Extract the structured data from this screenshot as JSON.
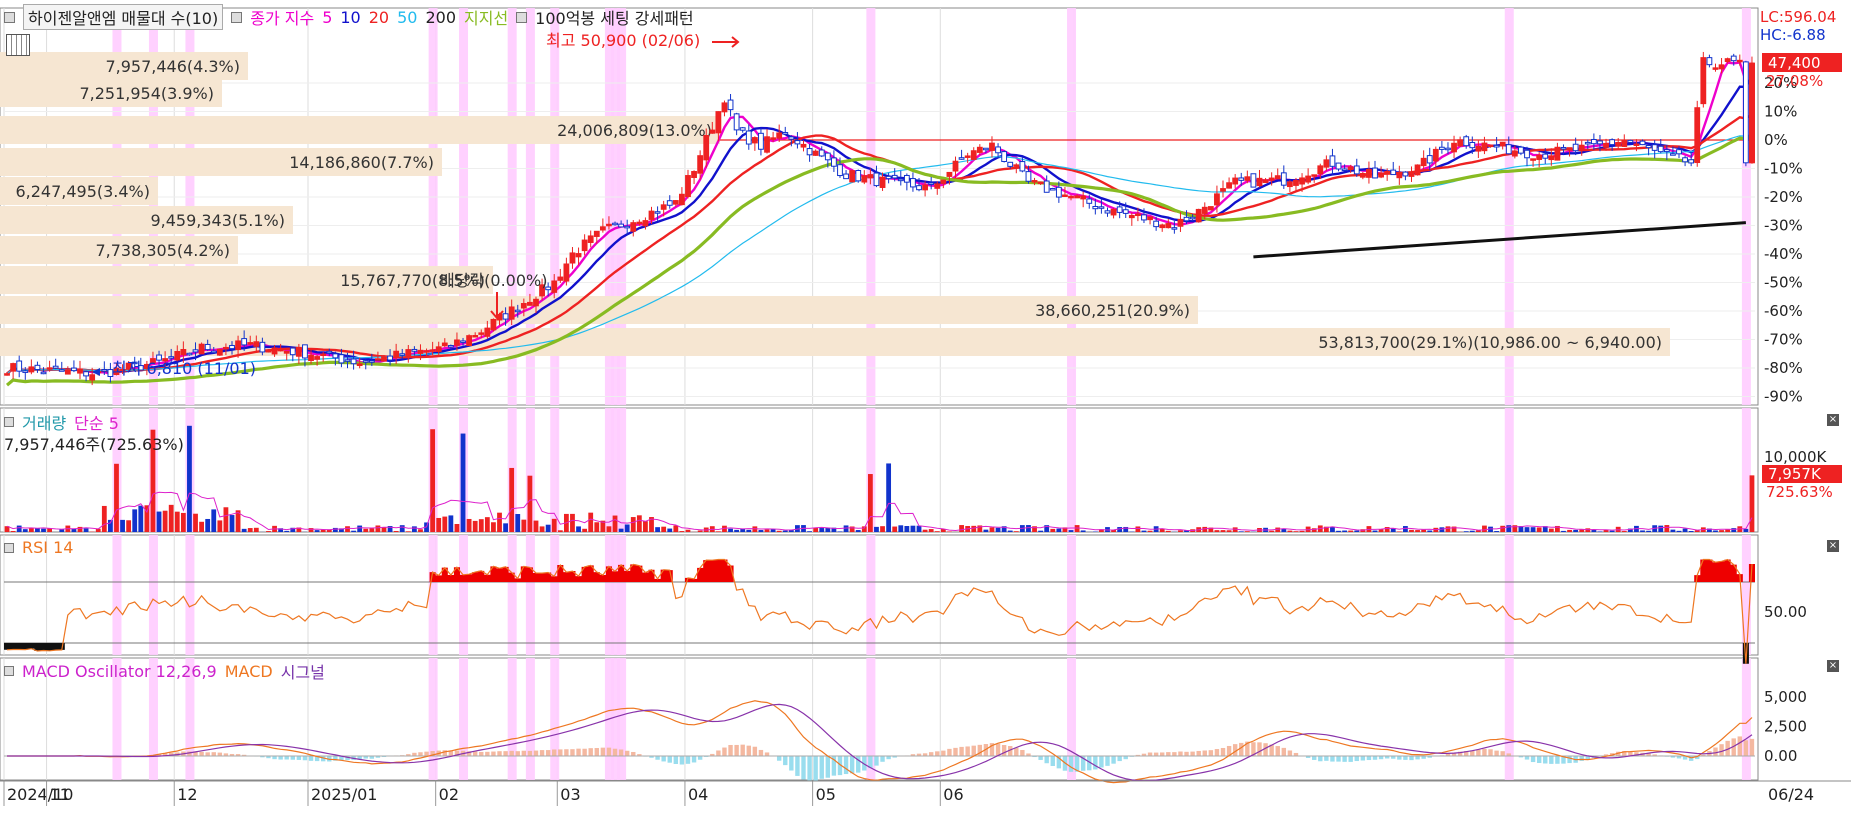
{
  "header": {
    "ticker": "하이젠알앤엠 매물대 수(10)",
    "ma_title": "종가 지수",
    "ma_periods": [
      "5",
      "10",
      "20",
      "50",
      "200"
    ],
    "ma_colors": [
      "#ee00cc",
      "#1111cc",
      "#ee2222",
      "#22bbee",
      "#222222"
    ],
    "support_label": "지지선",
    "support_color": "#88bb22",
    "pattern_label": "100억봉 세팅 강세패턴"
  },
  "price_panel": {
    "lc_label": "LC:596.04",
    "hc_label": "HC:-6.88",
    "current_price": "47,400",
    "current_pct": "27.08%",
    "high_note": "최고 50,900 (02/06)",
    "low_note": "최저 6,810 (11/01)",
    "dividend_note": "배당락(0.00%)",
    "pct_axis": [
      "20%",
      "10%",
      "0%",
      "-10%",
      "-20%",
      "-30%",
      "-40%",
      "-50%",
      "-60%",
      "-70%",
      "-80%",
      "-90%"
    ],
    "volume_profile": [
      {
        "label": "7,957,446(4.3%)",
        "share": 4.3
      },
      {
        "label": "7,251,954(3.9%)",
        "share": 3.9
      },
      {
        "label": "24,006,809(13.0%)",
        "share": 13.0
      },
      {
        "label": "14,186,860(7.7%)",
        "share": 7.7
      },
      {
        "label": "6,247,495(3.4%)",
        "share": 3.4
      },
      {
        "label": "9,459,343(5.1%)",
        "share": 5.1
      },
      {
        "label": "7,738,305(4.2%)",
        "share": 4.2
      },
      {
        "label": "15,767,770(8.5%)",
        "share": 8.5
      },
      {
        "label": "38,660,251(20.9%)",
        "share": 20.9
      },
      {
        "label": "53,813,700(29.1%)(10,986.00 ~ 6,940.00)",
        "share": 29.1
      }
    ]
  },
  "volume_panel": {
    "title": "거래량",
    "ma_label": "단순 5",
    "current": "7,957,446주(725.63%)",
    "axis_label": "10,000K",
    "badge": "7,957K",
    "badge_pct": "725.63%"
  },
  "rsi_panel": {
    "title": "RSI 14",
    "axis_label": "50.00"
  },
  "macd_panel": {
    "title": "MACD Oscillator 12,26,9",
    "macd_label": "MACD",
    "signal_label": "시그널",
    "axis_labels": [
      "5,000",
      "2,500",
      "0.00"
    ]
  },
  "x_axis": {
    "labels": [
      "2024/10",
      "11",
      "12",
      "2025/01",
      "02",
      "03",
      "04",
      "05",
      "06"
    ],
    "right_label": "06/24"
  },
  "chart_data": {
    "type": "candlestick",
    "x_range": [
      "2024-10-23",
      "2025-06-24"
    ],
    "months": [
      "2024/10",
      "11",
      "12",
      "2025/01",
      "02",
      "03",
      "04",
      "05",
      "06"
    ],
    "close_pct_keypoints": [
      {
        "i": 0,
        "pct": -80
      },
      {
        "i": 15,
        "pct": -82
      },
      {
        "i": 25,
        "pct": -78
      },
      {
        "i": 32,
        "pct": -73
      },
      {
        "i": 40,
        "pct": -72
      },
      {
        "i": 50,
        "pct": -75
      },
      {
        "i": 58,
        "pct": -78
      },
      {
        "i": 66,
        "pct": -75
      },
      {
        "i": 72,
        "pct": -73
      },
      {
        "i": 78,
        "pct": -67
      },
      {
        "i": 85,
        "pct": -57
      },
      {
        "i": 90,
        "pct": -50
      },
      {
        "i": 93,
        "pct": -40
      },
      {
        "i": 98,
        "pct": -32
      },
      {
        "i": 103,
        "pct": -28
      },
      {
        "i": 110,
        "pct": -22
      },
      {
        "i": 113,
        "pct": -10
      },
      {
        "i": 116,
        "pct": 5
      },
      {
        "i": 118,
        "pct": 15
      },
      {
        "i": 120,
        "pct": 3
      },
      {
        "i": 124,
        "pct": -2
      },
      {
        "i": 128,
        "pct": 3
      },
      {
        "i": 133,
        "pct": -5
      },
      {
        "i": 138,
        "pct": -12
      },
      {
        "i": 145,
        "pct": -15
      },
      {
        "i": 152,
        "pct": -17
      },
      {
        "i": 158,
        "pct": -5
      },
      {
        "i": 162,
        "pct": -2
      },
      {
        "i": 168,
        "pct": -15
      },
      {
        "i": 175,
        "pct": -20
      },
      {
        "i": 182,
        "pct": -25
      },
      {
        "i": 188,
        "pct": -28
      },
      {
        "i": 192,
        "pct": -30
      },
      {
        "i": 196,
        "pct": -25
      },
      {
        "i": 202,
        "pct": -15
      },
      {
        "i": 210,
        "pct": -14
      },
      {
        "i": 218,
        "pct": -8
      },
      {
        "i": 225,
        "pct": -13
      },
      {
        "i": 232,
        "pct": -10
      },
      {
        "i": 238,
        "pct": 0
      },
      {
        "i": 244,
        "pct": -2
      },
      {
        "i": 252,
        "pct": -5
      },
      {
        "i": 260,
        "pct": -3
      },
      {
        "i": 266,
        "pct": 0
      },
      {
        "i": 272,
        "pct": -5
      },
      {
        "i": 277,
        "pct": -8
      },
      {
        "i": 279,
        "pct": 27
      }
    ],
    "ma200": {
      "x": [
        205,
        286
      ],
      "pct": [
        -41,
        -29
      ]
    },
    "hline_pct": 0
  }
}
